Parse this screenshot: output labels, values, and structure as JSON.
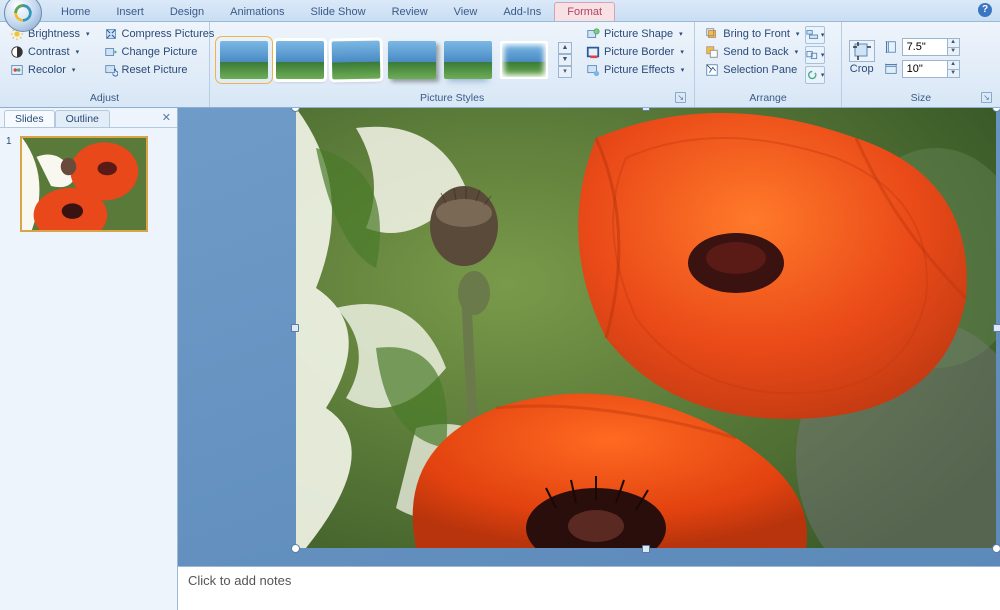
{
  "tabs": {
    "home": "Home",
    "insert": "Insert",
    "design": "Design",
    "animations": "Animations",
    "slideshow": "Slide Show",
    "review": "Review",
    "view": "View",
    "addins": "Add-Ins",
    "format": "Format"
  },
  "ribbon": {
    "adjust": {
      "brightness": "Brightness",
      "contrast": "Contrast",
      "recolor": "Recolor",
      "compress": "Compress Pictures",
      "change": "Change Picture",
      "reset": "Reset Picture",
      "label": "Adjust"
    },
    "picture_styles": {
      "shape": "Picture Shape",
      "border": "Picture Border",
      "effects": "Picture Effects",
      "label": "Picture Styles"
    },
    "arrange": {
      "front": "Bring to Front",
      "back": "Send to Back",
      "selection": "Selection Pane",
      "label": "Arrange"
    },
    "size": {
      "crop": "Crop",
      "height_value": "7.5\"",
      "width_value": "10\"",
      "label": "Size"
    }
  },
  "sidepane": {
    "slides_tab": "Slides",
    "outline_tab": "Outline",
    "slide_number": "1"
  },
  "notes_placeholder": "Click to add notes"
}
